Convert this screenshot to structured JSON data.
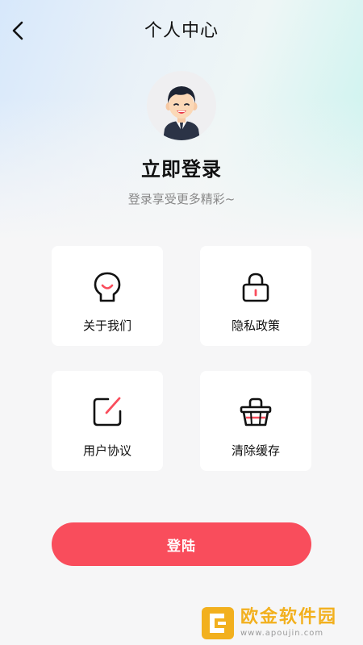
{
  "header": {
    "title": "个人中心",
    "back_icon": "chevron-left-icon"
  },
  "profile": {
    "avatar_icon": "user-avatar-icon",
    "login_title": "立即登录",
    "login_subtitle": "登录享受更多精彩~"
  },
  "menu": [
    {
      "label": "关于我们",
      "icon": "about-bubble-icon"
    },
    {
      "label": "隐私政策",
      "icon": "lock-icon"
    },
    {
      "label": "用户协议",
      "icon": "edit-document-icon"
    },
    {
      "label": "清除缓存",
      "icon": "basket-icon"
    }
  ],
  "login_button": {
    "label": "登陆"
  },
  "colors": {
    "accent": "#f94d5c",
    "text": "#111111",
    "muted": "#888888",
    "watermark": "#f2b01e"
  },
  "watermark": {
    "name": "欧金软件园",
    "url": "www.apoujin.com"
  }
}
